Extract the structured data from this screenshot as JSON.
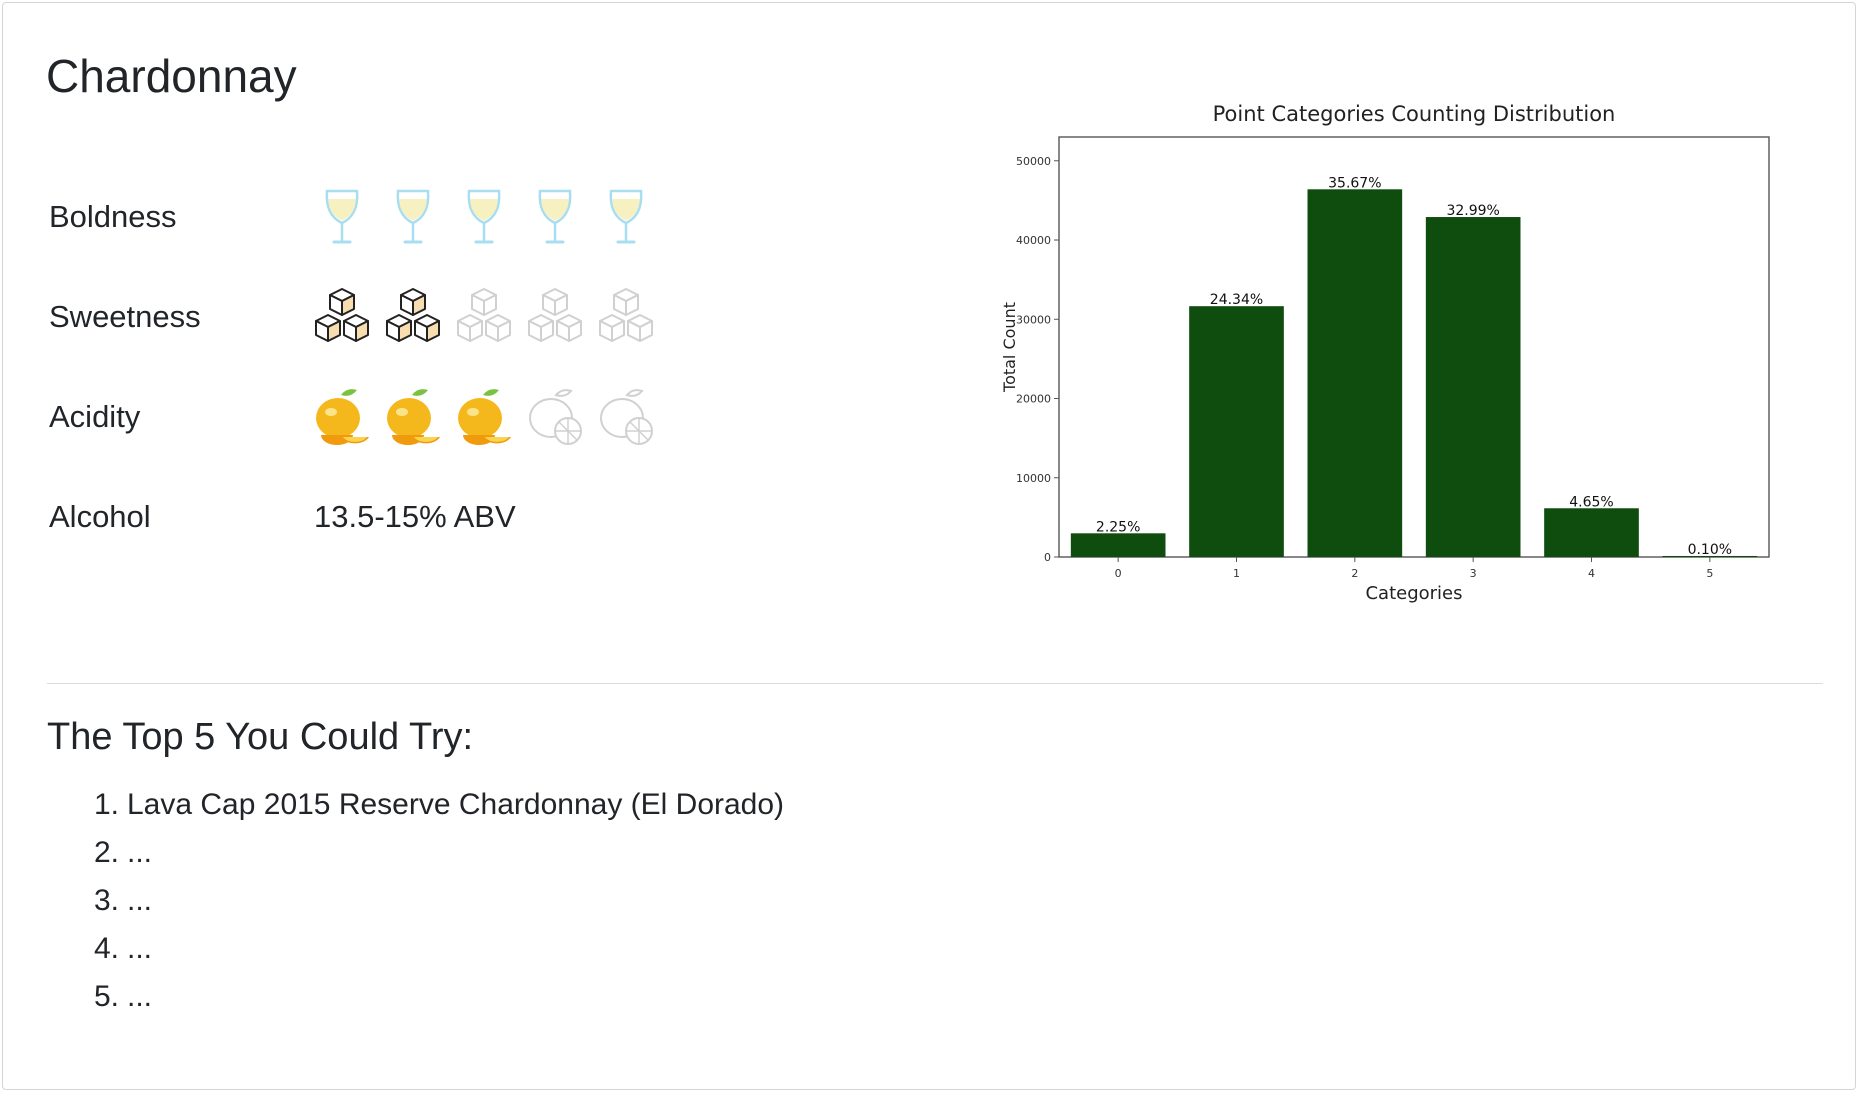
{
  "wine": {
    "name": "Chardonnay",
    "attributes": {
      "boldness": {
        "label": "Boldness",
        "icon": "wine-glass-icon",
        "level": 5,
        "max": 5
      },
      "sweetness": {
        "label": "Sweetness",
        "icon": "sugar-cubes-icon",
        "level": 2,
        "max": 5
      },
      "acidity": {
        "label": "Acidity",
        "icon": "lemon-icon",
        "level": 3,
        "max": 5
      },
      "alcohol": {
        "label": "Alcohol",
        "value": "13.5-15% ABV"
      }
    }
  },
  "recommendations": {
    "heading": "The Top 5 You Could Try:",
    "items": [
      {
        "num": "1.",
        "text": "Lava Cap 2015 Reserve Chardonnay (El Dorado)"
      },
      {
        "num": "2.",
        "text": "..."
      },
      {
        "num": "3.",
        "text": "..."
      },
      {
        "num": "4.",
        "text": "..."
      },
      {
        "num": "5.",
        "text": "..."
      }
    ]
  },
  "colors": {
    "bar": "#0f4d0f",
    "glass_wine": "#f7f0c0",
    "glass_outline": "#a9def0",
    "sugar_fill": "#f7ddb0",
    "lemon": "#f5b81c",
    "leaf": "#7cc242",
    "inactive": "#d0d0d0"
  },
  "chart_data": {
    "type": "bar",
    "title": "Point Categories Counting Distribution",
    "xlabel": "Categories",
    "ylabel": "Total Count",
    "categories": [
      "0",
      "1",
      "2",
      "3",
      "4",
      "5"
    ],
    "values": [
      2990,
      31650,
      46400,
      42900,
      6150,
      130
    ],
    "data_labels": [
      "2.25%",
      "24.34%",
      "35.67%",
      "32.99%",
      "4.65%",
      "0.10%"
    ],
    "yticks": [
      0,
      10000,
      20000,
      30000,
      40000,
      50000
    ],
    "ylim": [
      0,
      53000
    ],
    "grid": false,
    "legend": "none"
  }
}
